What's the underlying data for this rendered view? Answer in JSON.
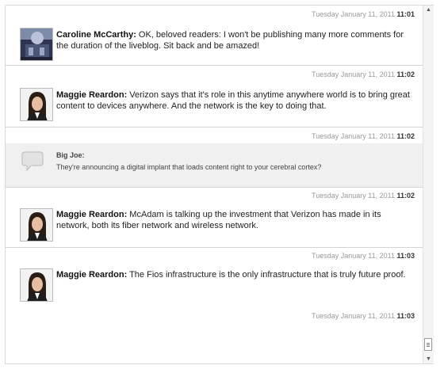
{
  "entries": [
    {
      "kind": "staff",
      "ts_date": "Tuesday January 11, 2011",
      "ts_time": "11:01",
      "author": "Caroline McCarthy:",
      "text": " OK, beloved readers: I won't be publishing many more comments for the duration of the liveblog. Sit back and be amazed!",
      "avatar": "caroline-avatar"
    },
    {
      "kind": "staff",
      "ts_date": "Tuesday January 11, 2011",
      "ts_time": "11:02",
      "author": "Maggie Reardon:",
      "text": " Verizon says that it's role in this anytime anywhere world is to bring great content to devices anywhere. And the network is the key to doing that.",
      "avatar": "maggie-avatar"
    },
    {
      "kind": "reader",
      "ts_date": "Tuesday January 11, 2011",
      "ts_time": "11:02",
      "author": "Big Joe:",
      "text": "They're announcing a digital implant that loads content right to your cerebral cortex?",
      "avatar": "speech-bubble-icon"
    },
    {
      "kind": "staff",
      "ts_date": "Tuesday January 11, 2011",
      "ts_time": "11:02",
      "author": "Maggie Reardon:",
      "text": " McAdam is talking up the investment that Verizon has made in its network, both its fiber network and wireless network.",
      "avatar": "maggie-avatar"
    },
    {
      "kind": "staff",
      "ts_date": "Tuesday January 11, 2011",
      "ts_time": "11:03",
      "author": "Maggie Reardon:",
      "text": " The Fios infrastructure is the only infrastructure that is truly future proof.",
      "avatar": "maggie-avatar"
    },
    {
      "kind": "staff",
      "ts_date": "Tuesday January 11, 2011",
      "ts_time": "11:03"
    }
  ],
  "scrollbar": {
    "up_glyph": "▲",
    "down_glyph": "▼"
  }
}
